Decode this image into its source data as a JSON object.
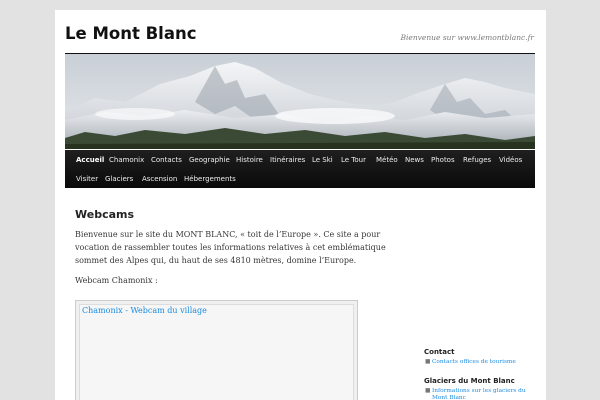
{
  "site": {
    "title": "Le Mont Blanc",
    "description": "Bienvenue sur www.lemontblanc.fr"
  },
  "nav": {
    "items": [
      {
        "label": "Accueil",
        "current": true
      },
      {
        "label": "Chamonix"
      },
      {
        "label": "Contacts"
      },
      {
        "label": "Geographie"
      },
      {
        "label": "Histoire"
      },
      {
        "label": "Itinéraires"
      },
      {
        "label": "Le Ski"
      },
      {
        "label": "Le Tour"
      },
      {
        "label": "Météo"
      },
      {
        "label": "News"
      },
      {
        "label": "Photos"
      },
      {
        "label": "Refuges"
      },
      {
        "label": "Vidéos"
      },
      {
        "label": "Visiter"
      },
      {
        "label": "Glaciers"
      },
      {
        "label": "Ascension"
      },
      {
        "label": "Hébergements"
      }
    ]
  },
  "content": {
    "title": "Webcams",
    "intro": "Bienvenue sur le site du MONT BLANC, « toit de l’Europe ». Ce site a pour vocation de rassembler toutes les informations relatives à cet emblématique sommet des Alpes qui, du haut de ses 4810 mètres, domine l’Europe.",
    "webcam_label": "Webcam Chamonix :",
    "webcam_link": "Chamonix - Webcam du village"
  },
  "sidebar": {
    "widgets": [
      {
        "title": "Contact",
        "links": [
          "Contacts offices de tourisme"
        ]
      },
      {
        "title": "Glaciers du Mont Blanc",
        "links": [
          "Informations sur les glaciers du Mont Blanc"
        ]
      }
    ]
  },
  "colors": {
    "background": "#e2e2e2",
    "nav_bar": "#111111",
    "link": "#1b8be0"
  }
}
